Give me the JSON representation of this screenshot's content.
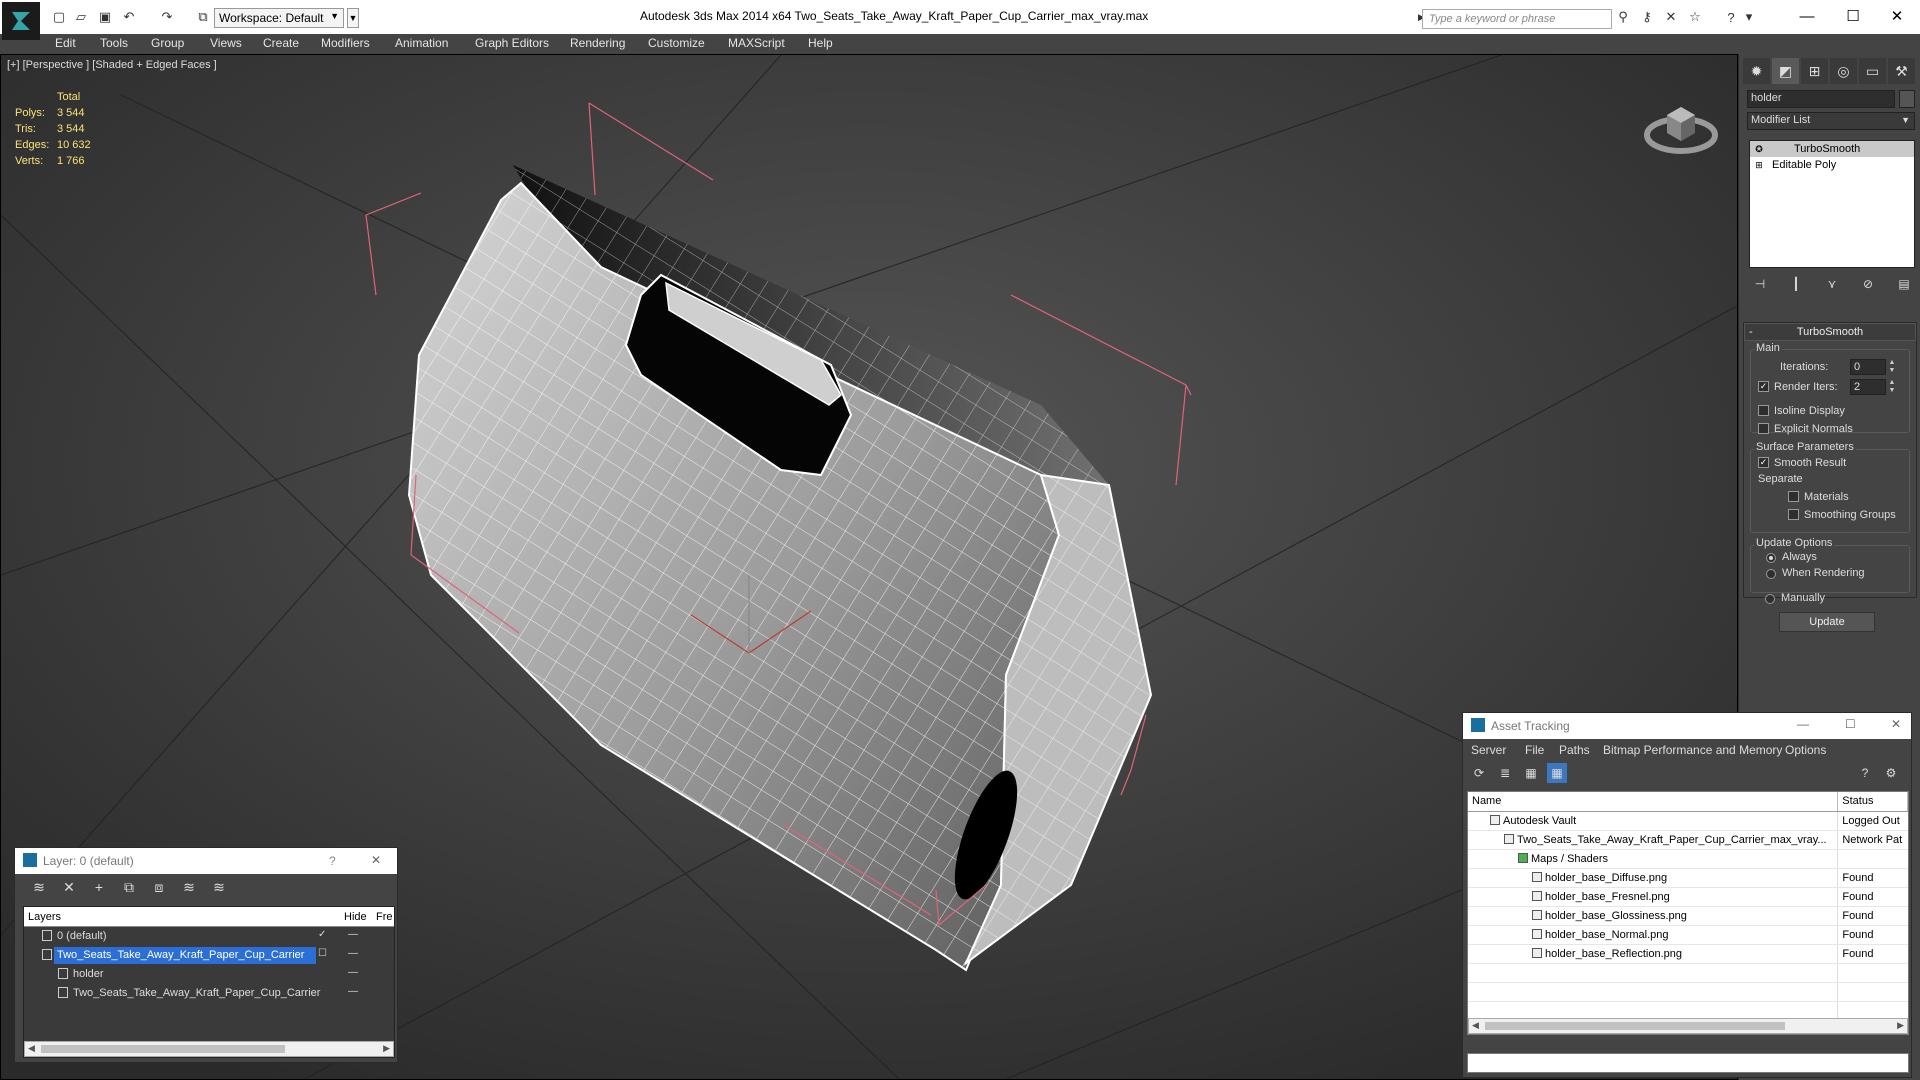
{
  "app": {
    "title": "Autodesk 3ds Max  2014 x64      Two_Seats_Take_Away_Kraft_Paper_Cup_Carrier_max_vray.max",
    "workspace": "Workspace: Default",
    "search_placeholder": "Type a keyword or phrase"
  },
  "menu": [
    "Edit",
    "Tools",
    "Group",
    "Views",
    "Create",
    "Modifiers",
    "Animation",
    "Graph Editors",
    "Rendering",
    "Customize",
    "MAXScript",
    "Help"
  ],
  "viewport": {
    "label": "[+] [Perspective ] [Shaded + Edged Faces ]",
    "stats": {
      "header": "Total",
      "rows": [
        {
          "k": "Polys:",
          "v": "3 544"
        },
        {
          "k": "Tris:",
          "v": "3 544"
        },
        {
          "k": "Edges:",
          "v": "10 632"
        },
        {
          "k": "Verts:",
          "v": "1 766"
        }
      ]
    }
  },
  "command_panel": {
    "object_name": "holder",
    "modifier_list": "Modifier List",
    "stack": [
      "TurboSmooth",
      "Editable Poly"
    ],
    "turbosmooth": {
      "title": "TurboSmooth",
      "main": "Main",
      "iterations_label": "Iterations:",
      "iterations": "0",
      "render_iters_label": "Render Iters:",
      "render_iters": "2",
      "isoline": "Isoline Display",
      "explicit_normals": "Explicit Normals",
      "surface_params": "Surface Parameters",
      "smooth_result": "Smooth Result",
      "separate": "Separate",
      "materials": "Materials",
      "smoothing_groups": "Smoothing Groups",
      "update_options": "Update Options",
      "always": "Always",
      "when_rendering": "When Rendering",
      "manually": "Manually",
      "update": "Update"
    }
  },
  "asset_tracking": {
    "title": "Asset Tracking",
    "menu": [
      "Server",
      "File",
      "Paths",
      "Bitmap Performance and Memory",
      "Options"
    ],
    "columns": [
      "Name",
      "Status"
    ],
    "rows": [
      {
        "name": "Autodesk Vault",
        "status": "Logged Out",
        "indent": 1
      },
      {
        "name": "Two_Seats_Take_Away_Kraft_Paper_Cup_Carrier_max_vray...",
        "status": "Network Pat",
        "indent": 2
      },
      {
        "name": "Maps / Shaders",
        "status": "",
        "indent": 3
      },
      {
        "name": "holder_base_Diffuse.png",
        "status": "Found",
        "indent": 4
      },
      {
        "name": "holder_base_Fresnel.png",
        "status": "Found",
        "indent": 4
      },
      {
        "name": "holder_base_Glossiness.png",
        "status": "Found",
        "indent": 4
      },
      {
        "name": "holder_base_Normal.png",
        "status": "Found",
        "indent": 4
      },
      {
        "name": "holder_base_Reflection.png",
        "status": "Found",
        "indent": 4
      }
    ]
  },
  "layer_window": {
    "title": "Layer: 0 (default)",
    "col_layers": "Layers",
    "col_hide": "Hide",
    "col_freeze": "Fre",
    "rows": [
      {
        "name": "0 (default)",
        "indent": 1
      },
      {
        "name": "Two_Seats_Take_Away_Kraft_Paper_Cup_Carrier",
        "indent": 1
      },
      {
        "name": "holder",
        "indent": 2
      },
      {
        "name": "Two_Seats_Take_Away_Kraft_Paper_Cup_Carrier",
        "indent": 2
      }
    ]
  },
  "colors": {
    "accent": "#2b6fd6",
    "stats_text": "#f7e37a",
    "gizmo": "#e0637a"
  }
}
